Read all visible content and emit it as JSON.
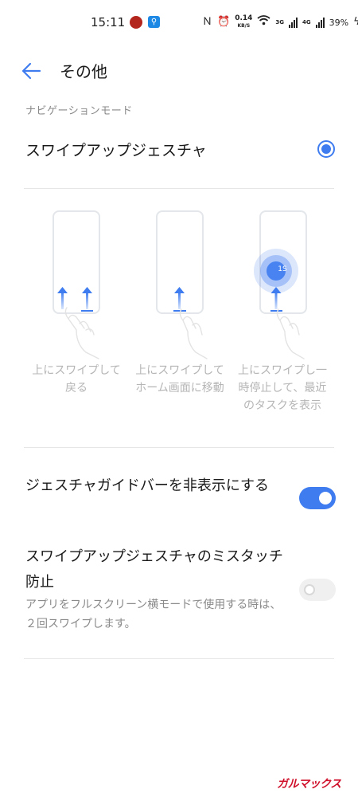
{
  "status_bar": {
    "time": "15:11",
    "net_speed_value": "0.14",
    "net_speed_unit": "KB/S",
    "net1": "3G",
    "net2": "4G",
    "battery": "39%"
  },
  "header": {
    "title": "その他"
  },
  "navigation": {
    "section_label": "ナビゲーションモード",
    "selected_option": "スワイプアップジェスチャ",
    "accent_color": "#3e7cf0"
  },
  "gestures": [
    {
      "caption_line1": "上にスワイプして",
      "caption_line2": "戻る"
    },
    {
      "caption_line1": "上にスワイプして",
      "caption_line2": "ホーム画面に移動"
    },
    {
      "caption_line1": "上にスワイプし一",
      "caption_line2": "時停止して、最近",
      "caption_line3": "のタスクを表示",
      "hold_label": "1S"
    }
  ],
  "settings": {
    "hide_bar_label": "ジェスチャガイドバーを非表示にする",
    "hide_bar_on": true,
    "mistouch_label": "スワイプアップジェスチャのミスタッチ防止",
    "mistouch_on": false,
    "mistouch_desc": "アプリをフルスクリーン横モードで使用する時は、２回スワイプします。"
  },
  "watermark": "ガルマックス"
}
